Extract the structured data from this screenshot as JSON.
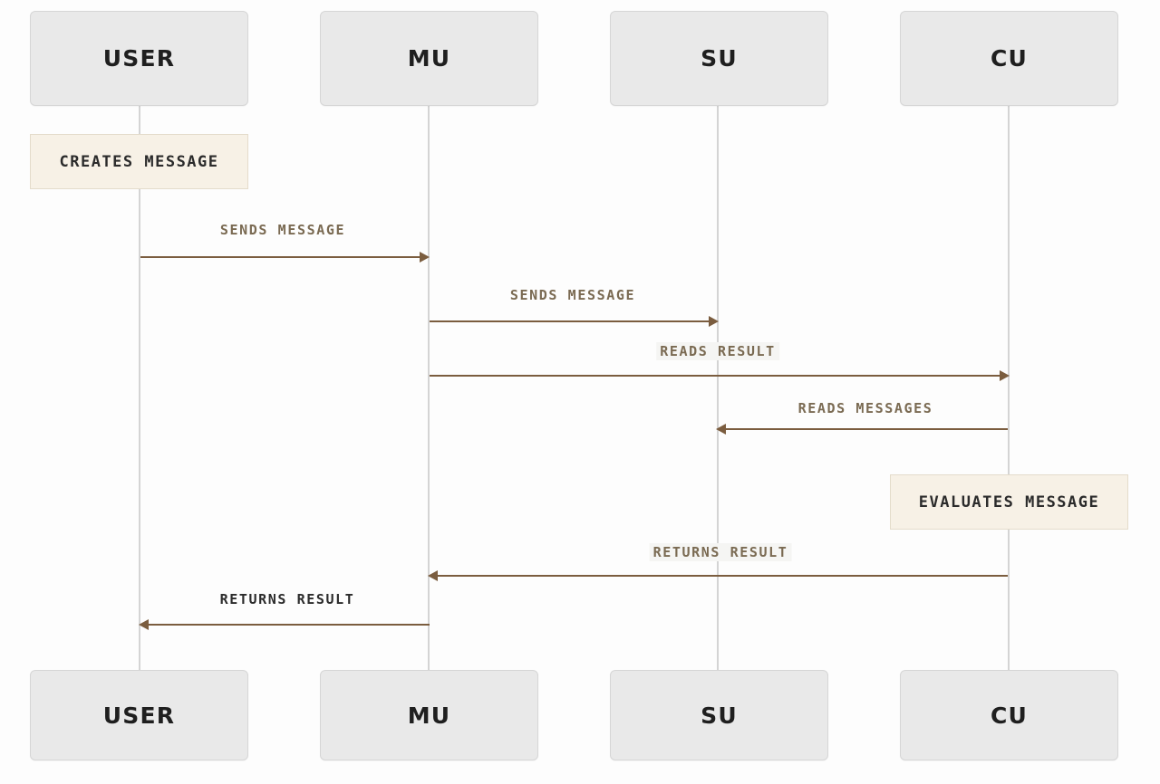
{
  "diagram": {
    "type": "sequence-diagram",
    "background_color": "#fdfdfd",
    "accent_color": "#7b5d3f",
    "participant_fill": "#e9e9e9",
    "note_fill": "#f7f1e6",
    "lifeline_color": "#d4d4d4"
  },
  "participants": [
    {
      "id": "user",
      "label": "USER"
    },
    {
      "id": "mu",
      "label": "MU"
    },
    {
      "id": "su",
      "label": "SU"
    },
    {
      "id": "cu",
      "label": "CU"
    }
  ],
  "participants_bottom": [
    {
      "id": "user",
      "label": "USER"
    },
    {
      "id": "mu",
      "label": "MU"
    },
    {
      "id": "su",
      "label": "SU"
    },
    {
      "id": "cu",
      "label": "CU"
    }
  ],
  "notes": [
    {
      "id": "note-creates-message",
      "label": "CREATES MESSAGE",
      "over": "user"
    },
    {
      "id": "note-evaluates-message",
      "label": "EVALUATES MESSAGE",
      "over": "cu"
    }
  ],
  "messages": [
    {
      "id": "msg-1",
      "label": "SENDS MESSAGE",
      "from": "user",
      "to": "mu",
      "direction": "right"
    },
    {
      "id": "msg-2",
      "label": "SENDS MESSAGE",
      "from": "mu",
      "to": "su",
      "direction": "right"
    },
    {
      "id": "msg-3",
      "label": "READS RESULT",
      "from": "mu",
      "to": "cu",
      "direction": "right"
    },
    {
      "id": "msg-4",
      "label": "READS MESSAGES",
      "from": "cu",
      "to": "su",
      "direction": "left"
    },
    {
      "id": "msg-5",
      "label": "RETURNS RESULT",
      "from": "cu",
      "to": "mu",
      "direction": "left"
    },
    {
      "id": "msg-6",
      "label": "RETURNS RESULT",
      "from": "mu",
      "to": "user",
      "direction": "left"
    }
  ]
}
